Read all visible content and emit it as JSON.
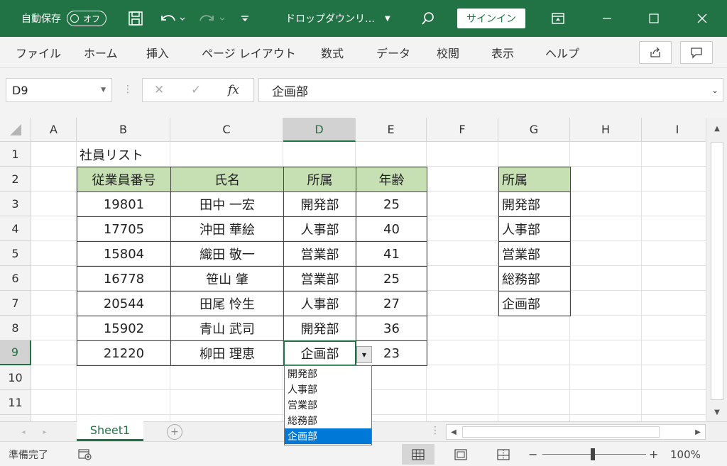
{
  "titlebar": {
    "autosave_label": "自動保存",
    "autosave_state": "オフ",
    "filename": "ドロップダウンリ…",
    "signin": "サインイン"
  },
  "ribbon": {
    "tabs": [
      "ファイル",
      "ホーム",
      "挿入",
      "ページ レイアウト",
      "数式",
      "データ",
      "校閲",
      "表示",
      "ヘルプ"
    ]
  },
  "formula_bar": {
    "name_box": "D9",
    "fx": "fx",
    "value": "企画部"
  },
  "columns": [
    "A",
    "B",
    "C",
    "D",
    "E",
    "F",
    "G",
    "H",
    "I"
  ],
  "rows": [
    "1",
    "2",
    "3",
    "4",
    "5",
    "6",
    "7",
    "8",
    "9",
    "10",
    "11"
  ],
  "sheet": {
    "title": "社員リスト",
    "table_headers": [
      "従業員番号",
      "氏名",
      "所属",
      "年齢"
    ],
    "table_rows": [
      [
        "19801",
        "田中 一宏",
        "開発部",
        "25"
      ],
      [
        "17705",
        "沖田 華絵",
        "人事部",
        "40"
      ],
      [
        "15804",
        "織田 敬一",
        "営業部",
        "41"
      ],
      [
        "16778",
        "笹山 肇",
        "営業部",
        "25"
      ],
      [
        "20544",
        "田尾 怜生",
        "人事部",
        "27"
      ],
      [
        "15902",
        "青山 武司",
        "開発部",
        "36"
      ],
      [
        "21220",
        "柳田 理恵",
        "企画部",
        "23"
      ]
    ],
    "dept_header": "所属",
    "dept_list": [
      "開発部",
      "人事部",
      "営業部",
      "総務部",
      "企画部"
    ]
  },
  "dropdown": {
    "options": [
      "開発部",
      "人事部",
      "営業部",
      "総務部",
      "企画部"
    ],
    "selected": "企画部"
  },
  "sheet_tabs": [
    "Sheet1"
  ],
  "status": {
    "ready": "準備完了",
    "zoom": "100%"
  },
  "colors": {
    "excel_green": "#217346",
    "header_fill": "#c6e0b4",
    "dropdown_highlight": "#0078d7"
  }
}
